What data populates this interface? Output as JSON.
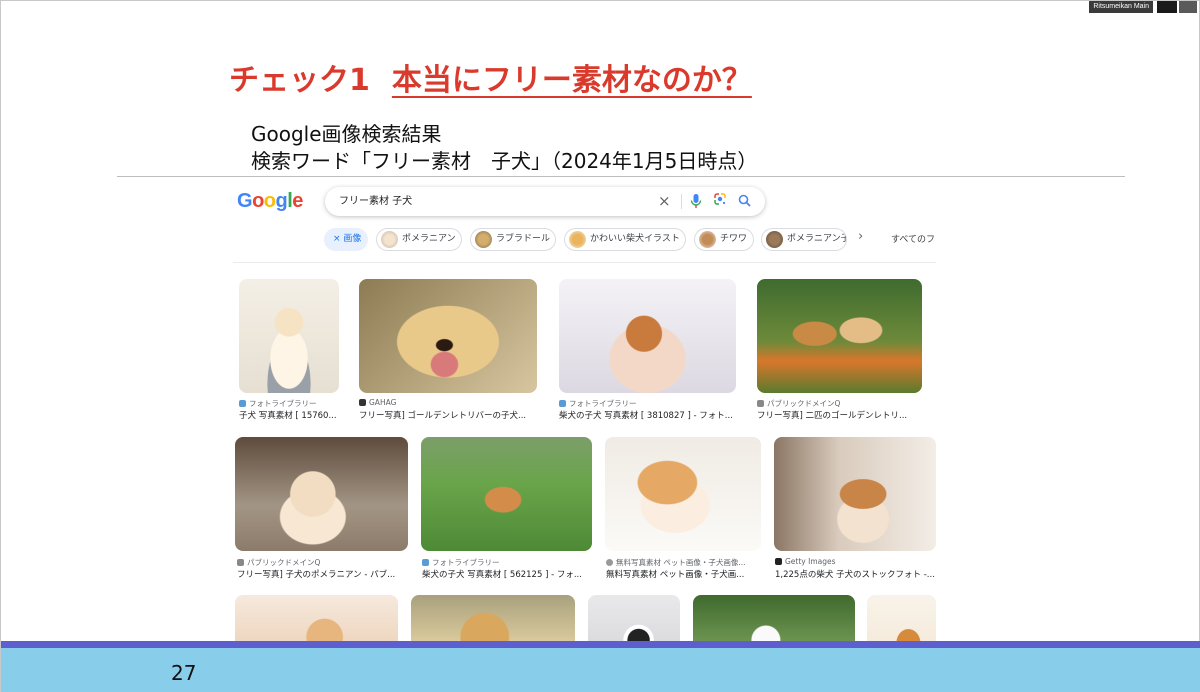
{
  "overlay": {
    "video_label": "Ritsumeikan Main"
  },
  "slide": {
    "title_check": "チェック1",
    "title_question": "本当にフリー素材なのか？",
    "subtitle1": "Google画像検索結果",
    "subtitle2": "検索ワード「フリー素材　子犬」（2024年1月5日時点）",
    "page_number": "27"
  },
  "google": {
    "logo": [
      "G",
      "o",
      "o",
      "g",
      "l",
      "e"
    ],
    "logo_colors": [
      "#4285F4",
      "#EA4335",
      "#FBBC05",
      "#4285F4",
      "#34A853",
      "#EA4335"
    ],
    "search_query": "フリー素材 子犬",
    "clear_icon": "×",
    "chips": {
      "images": "× 画像",
      "c1": "ポメラニアン",
      "c2": "ラブラドール",
      "c3": "かわいい柴犬イラスト",
      "c4": "チワワ",
      "c5": "ポメラニアン子",
      "more": "›",
      "all": "すべてのフ"
    },
    "results_row1": [
      {
        "source": "フォトライブラリー",
        "caption": "子犬 写真素材 [ 15760...",
        "source_color": "#5b9bd5"
      },
      {
        "source": "GAHAG",
        "caption": "フリー写真] ゴールデンレトリバーの子犬...",
        "source_color": "#333333"
      },
      {
        "source": "フォトライブラリー",
        "caption": "柴犬の子犬 写真素材 [ 3810827 ] - フォト...",
        "source_color": "#5b9bd5"
      },
      {
        "source": "パブリックドメインQ",
        "caption": "フリー写真] 二匹のゴールデンレトリ...",
        "source_color": "#888888"
      }
    ],
    "results_row2": [
      {
        "source": "パブリックドメインQ",
        "caption": "フリー写真] 子犬のポメラニアン - パブ...",
        "source_color": "#888888"
      },
      {
        "source": "フォトライブラリー",
        "caption": "柴犬の子犬 写真素材 [ 562125 ] - フォ...",
        "source_color": "#5b9bd5"
      },
      {
        "source": "無料写真素材 ペット画像・子犬画像...",
        "caption": "無料写真素材 ペット画像・子犬画...",
        "source_color": "#999999"
      },
      {
        "source": "Getty Images",
        "caption": "1,225点の柴犬 子犬のストックフォト -...",
        "source_color": "#222222"
      }
    ]
  }
}
